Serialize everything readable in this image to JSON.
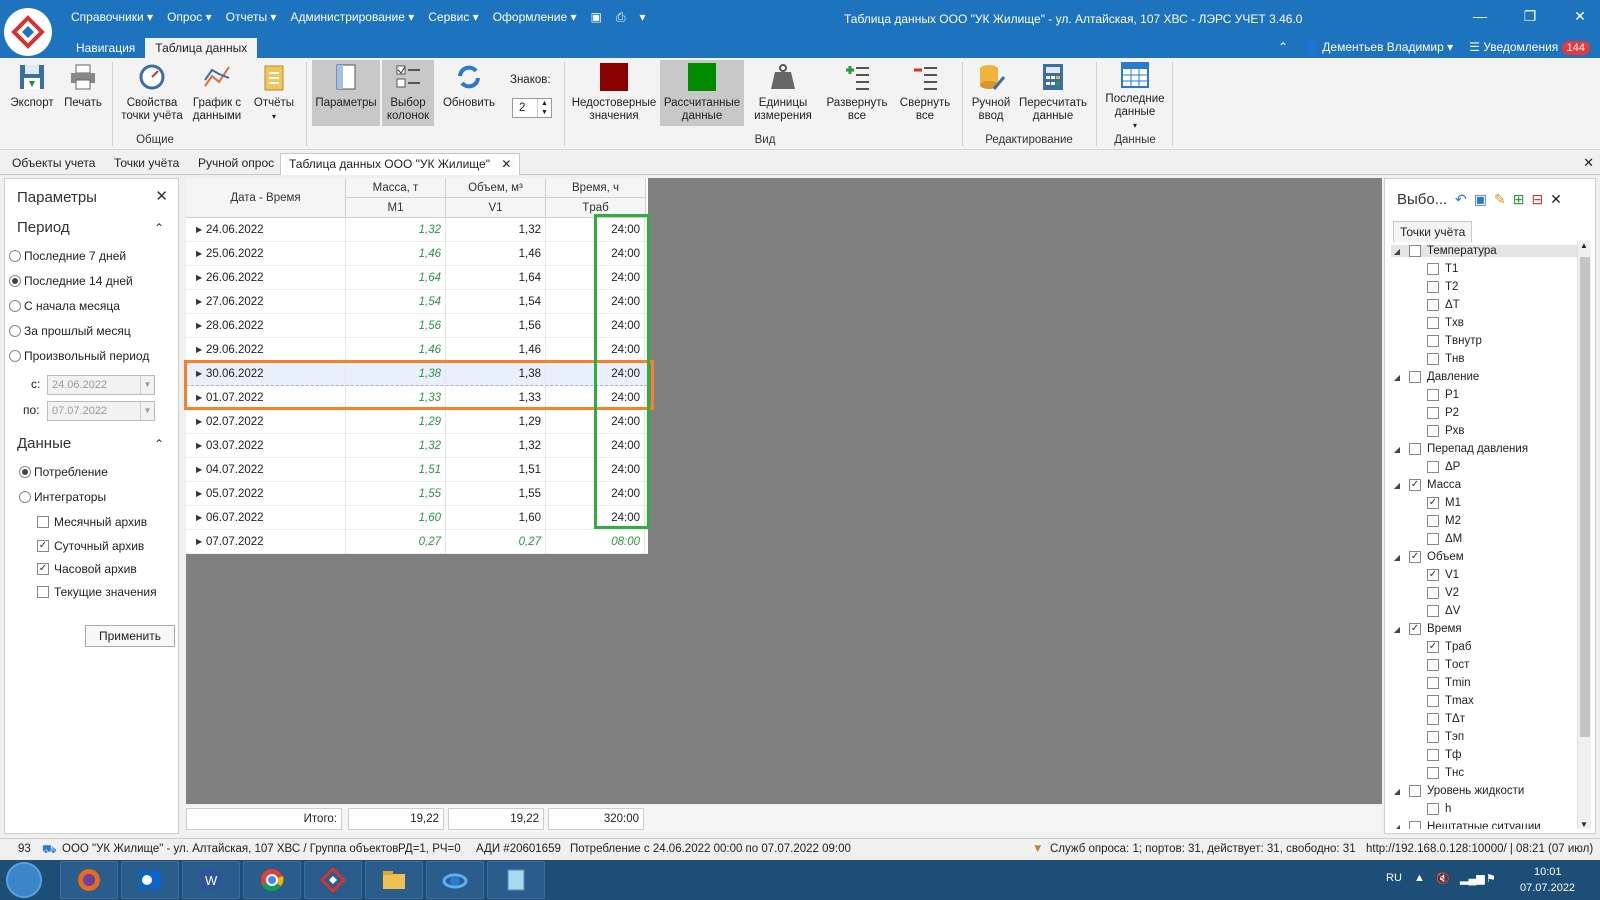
{
  "app": {
    "title": "Таблица данных ООО \"УК Жилище\" - ул. Алтайская, 107 ХВС - ЛЭРС УЧЕТ 3.46.0",
    "menu": [
      "Справочники ▾",
      "Опрос ▾",
      "Отчеты ▾",
      "Администрирование ▾",
      "Сервис ▾",
      "Оформление ▾"
    ],
    "nav_tabs": [
      "Навигация",
      "Таблица данных"
    ],
    "user": "Дементьев Владимир ▾",
    "notifications_label": "Уведомления",
    "notifications_count": "144"
  },
  "ribbon": {
    "buttons": {
      "export": "Экспорт",
      "print": "Печать",
      "point_props": "Свойства точки учёта",
      "chart": "График с данными",
      "reports": "Отчёты",
      "params": "Параметры",
      "columns": "Выбор колонок",
      "refresh": "Обновить",
      "digits_label": "Знаков:",
      "digits_value": "2",
      "invalid": "Недостоверные значения",
      "calculated": "Рассчитанные данные",
      "units": "Единицы измерения",
      "expand": "Развернуть все",
      "collapse": "Свернуть все",
      "manual": "Ручной ввод",
      "recalc": "Пересчитать данные",
      "last": "Последние данные"
    },
    "groups": {
      "general": "Общие",
      "view": "Вид",
      "edit": "Редактирование",
      "data": "Данные"
    }
  },
  "doc_tabs": [
    "Объекты учета",
    "Точки учёта",
    "Ручной опрос",
    "Таблица данных ООО \"УК Жилище\""
  ],
  "params_panel": {
    "title": "Параметры",
    "period_title": "Период",
    "period_options": [
      "Последние 7 дней",
      "Последние 14 дней",
      "С начала месяца",
      "За прошлый месяц",
      "Произвольный период"
    ],
    "from_label": "с:",
    "from_value": "24.06.2022",
    "to_label": "по:",
    "to_value": "07.07.2022",
    "data_title": "Данные",
    "data_options": [
      "Потребление",
      "Интеграторы"
    ],
    "archives": [
      "Месячный архив",
      "Суточный архив",
      "Часовой архив",
      "Текущие значения"
    ],
    "apply": "Применить"
  },
  "grid": {
    "headers": {
      "date": "Дата - Время",
      "mass": "Масса, т",
      "volume": "Объем, м³",
      "time": "Время, ч",
      "m1": "M1",
      "v1": "V1",
      "trab": "Tраб"
    },
    "rows": [
      {
        "date": "24.06.2022",
        "m1": "1,32",
        "v1": "1,32",
        "trab": "24:00"
      },
      {
        "date": "25.06.2022",
        "m1": "1,46",
        "v1": "1,46",
        "trab": "24:00"
      },
      {
        "date": "26.06.2022",
        "m1": "1,64",
        "v1": "1,64",
        "trab": "24:00"
      },
      {
        "date": "27.06.2022",
        "m1": "1,54",
        "v1": "1,54",
        "trab": "24:00"
      },
      {
        "date": "28.06.2022",
        "m1": "1,56",
        "v1": "1,56",
        "trab": "24:00"
      },
      {
        "date": "29.06.2022",
        "m1": "1,46",
        "v1": "1,46",
        "trab": "24:00"
      },
      {
        "date": "30.06.2022",
        "m1": "1,38",
        "v1": "1,38",
        "trab": "24:00"
      },
      {
        "date": "01.07.2022",
        "m1": "1,33",
        "v1": "1,33",
        "trab": "24:00"
      },
      {
        "date": "02.07.2022",
        "m1": "1,29",
        "v1": "1,29",
        "trab": "24:00"
      },
      {
        "date": "03.07.2022",
        "m1": "1,32",
        "v1": "1,32",
        "trab": "24:00"
      },
      {
        "date": "04.07.2022",
        "m1": "1,51",
        "v1": "1,51",
        "trab": "24:00"
      },
      {
        "date": "05.07.2022",
        "m1": "1,55",
        "v1": "1,55",
        "trab": "24:00"
      },
      {
        "date": "06.07.2022",
        "m1": "1,60",
        "v1": "1,60",
        "trab": "24:00"
      },
      {
        "date": "07.07.2022",
        "m1": "0,27",
        "v1": "0,27",
        "trab": "08:00"
      }
    ],
    "totals": {
      "label": "Итого:",
      "m1": "19,22",
      "v1": "19,22",
      "trab": "320:00"
    }
  },
  "select_panel": {
    "title": "Выбо...",
    "tab": "Точки учёта",
    "tree": [
      {
        "label": "Температура",
        "level": 0,
        "checked": false
      },
      {
        "label": "T1",
        "level": 1,
        "checked": false
      },
      {
        "label": "T2",
        "level": 1,
        "checked": false
      },
      {
        "label": "ΔT",
        "level": 1,
        "checked": false
      },
      {
        "label": "Tхв",
        "level": 1,
        "checked": false
      },
      {
        "label": "Tвнутр",
        "level": 1,
        "checked": false
      },
      {
        "label": "Tнв",
        "level": 1,
        "checked": false
      },
      {
        "label": "Давление",
        "level": 0,
        "checked": false
      },
      {
        "label": "P1",
        "level": 1,
        "checked": false
      },
      {
        "label": "P2",
        "level": 1,
        "checked": false
      },
      {
        "label": "Pхв",
        "level": 1,
        "checked": false
      },
      {
        "label": "Перепад давления",
        "level": 0,
        "checked": false
      },
      {
        "label": "ΔP",
        "level": 1,
        "checked": false
      },
      {
        "label": "Масса",
        "level": 0,
        "checked": true
      },
      {
        "label": "M1",
        "level": 1,
        "checked": true
      },
      {
        "label": "M2",
        "level": 1,
        "checked": false
      },
      {
        "label": "ΔM",
        "level": 1,
        "checked": false
      },
      {
        "label": "Объем",
        "level": 0,
        "checked": true
      },
      {
        "label": "V1",
        "level": 1,
        "checked": true
      },
      {
        "label": "V2",
        "level": 1,
        "checked": false
      },
      {
        "label": "ΔV",
        "level": 1,
        "checked": false
      },
      {
        "label": "Время",
        "level": 0,
        "checked": true
      },
      {
        "label": "Tраб",
        "level": 1,
        "checked": true
      },
      {
        "label": "Tост",
        "level": 1,
        "checked": false
      },
      {
        "label": "Tmin",
        "level": 1,
        "checked": false
      },
      {
        "label": "Tmax",
        "level": 1,
        "checked": false
      },
      {
        "label": "TΔт",
        "level": 1,
        "checked": false
      },
      {
        "label": "Tэп",
        "level": 1,
        "checked": false
      },
      {
        "label": "Tф",
        "level": 1,
        "checked": false
      },
      {
        "label": "Tнс",
        "level": 1,
        "checked": false
      },
      {
        "label": "Уровень жидкости",
        "level": 0,
        "checked": false
      },
      {
        "label": "h",
        "level": 1,
        "checked": false
      },
      {
        "label": "Нештатные ситуации",
        "level": 0,
        "checked": false
      }
    ]
  },
  "status": {
    "count": "93",
    "object": "ООО \"УК Жилище\" - ул. Алтайская, 107 ХВС / Группа объектов",
    "rd": "РД=1, РЧ=0",
    "adi": "АДИ #20601659",
    "period": "Потребление с 24.06.2022 00:00 по 07.07.2022 09:00",
    "service": "Служб опроса: 1; портов: 31, действует: 31, свободно: 31",
    "server": "http://192.168.0.128:10000/ | 08:21 (07 июл)"
  },
  "taskbar": {
    "lang": "RU",
    "time": "10:01",
    "date": "07.07.2022"
  },
  "colors": {
    "title_blue": "#1e73be",
    "invalid_red": "#8b0000",
    "calc_green": "#008a00",
    "highlight_orange": "#f5822b",
    "highlight_green": "#2eae3c"
  }
}
